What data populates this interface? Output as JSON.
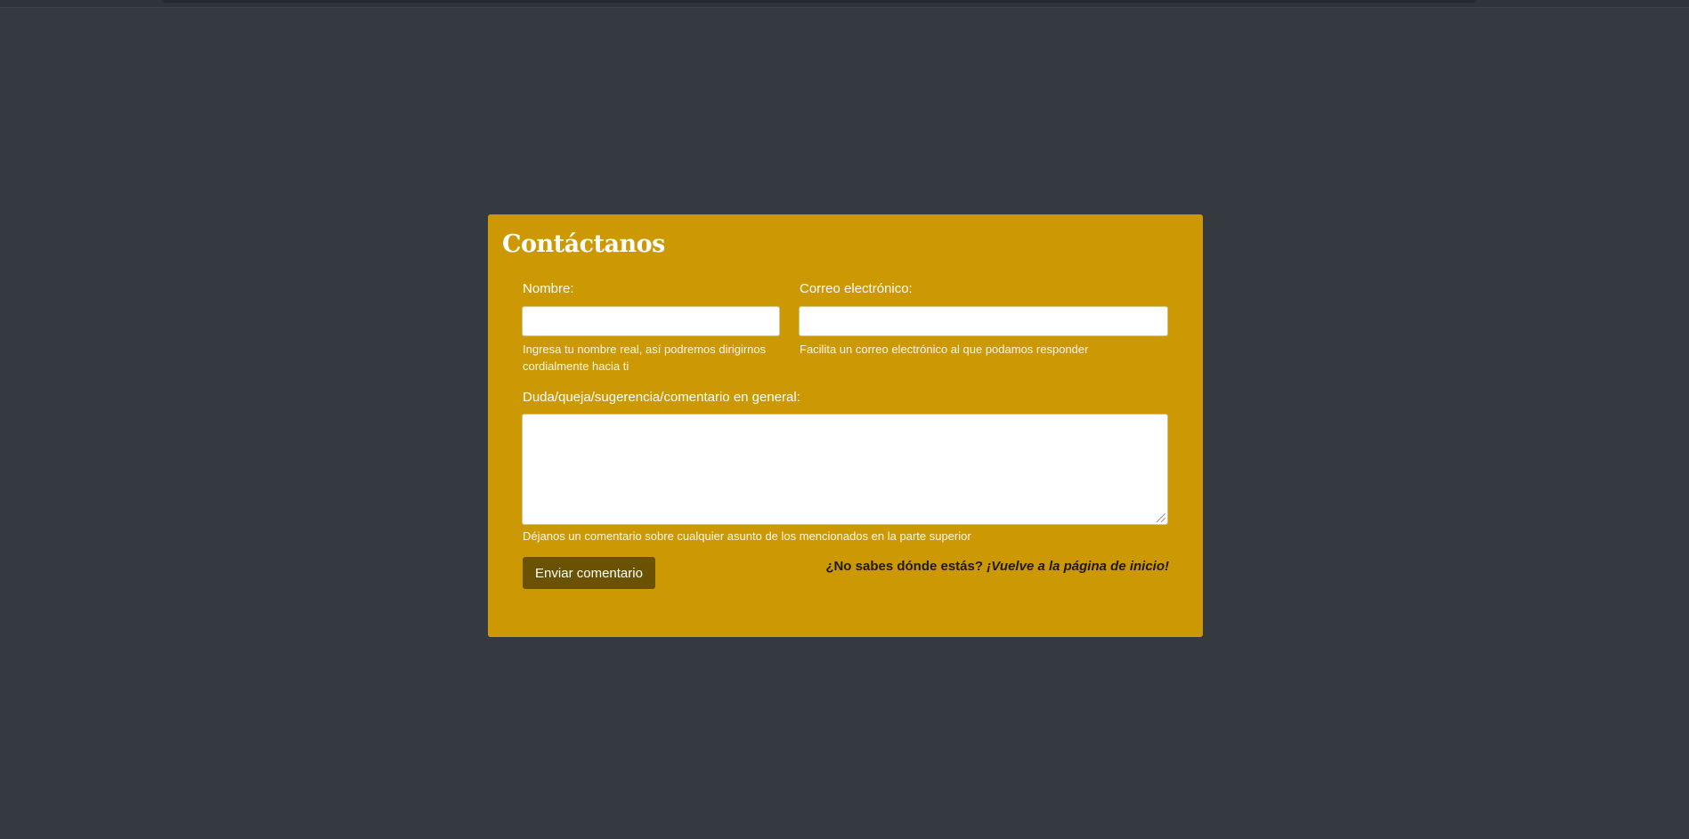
{
  "contact": {
    "title": "Contáctanos",
    "name_label": "Nombre:",
    "name_value": "",
    "name_help": "Ingresa tu nombre real, así podremos dirigirnos cordialmente hacia ti",
    "email_label": "Correo electrónico:",
    "email_value": "",
    "email_help": "Facilita un correo electrónico al que podamos responder",
    "comment_label": "Duda/queja/sugerencia/comentario en general:",
    "comment_value": "",
    "comment_help": "Déjanos un comentario sobre cualquier asunto de los mencionados en la parte superior",
    "submit_label": "Enviar comentario",
    "home_prompt": "¿No sabes dónde estás?",
    "home_link": "¡Vuelve a la página de inicio!"
  },
  "colors": {
    "page_background": "#343a40",
    "card_background": "#cc9904",
    "button_background": "#6a5202",
    "text_light": "#ffffff",
    "text_dark": "#1f1a0a"
  }
}
